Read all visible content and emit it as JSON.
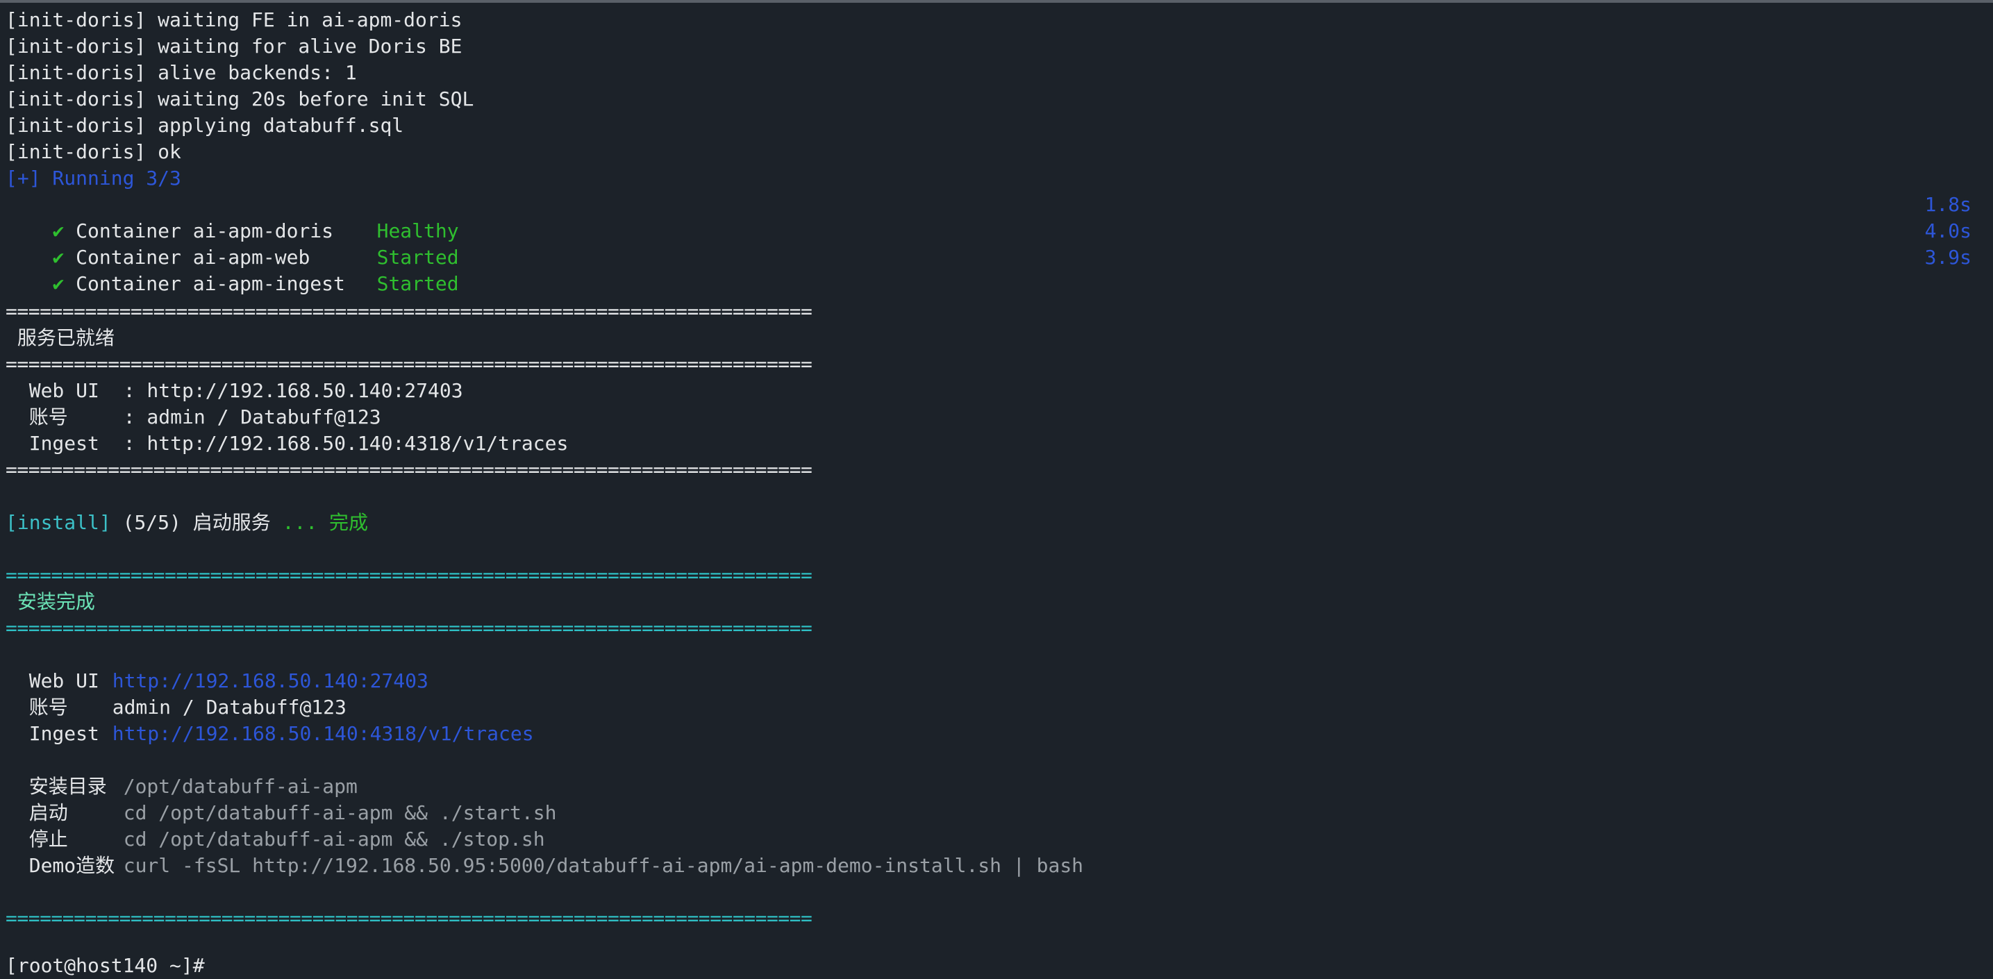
{
  "log_lines": [
    "[init-doris] waiting FE in ai-apm-doris",
    "[init-doris] waiting for alive Doris BE",
    "[init-doris] alive backends: 1",
    "[init-doris] waiting 20s before init SQL",
    "[init-doris] applying databuff.sql",
    "[init-doris] ok"
  ],
  "running": "[+] Running 3/3",
  "containers": [
    {
      "check": "✔",
      "label": "Container",
      "name": "ai-apm-doris",
      "status": "Healthy",
      "time": "1.8s"
    },
    {
      "check": "✔",
      "label": "Container",
      "name": "ai-apm-web",
      "status": "Started",
      "time": "4.0s"
    },
    {
      "check": "✔",
      "label": "Container",
      "name": "ai-apm-ingest",
      "status": "Started",
      "time": "3.9s"
    }
  ],
  "separator": "=======================================================================",
  "ready_title": "服务已就绪",
  "ready_info": [
    {
      "key": "Web UI",
      "value": ": http://192.168.50.140:27403"
    },
    {
      "key": "账号",
      "value": ": admin / Databuff@123"
    },
    {
      "key": "Ingest",
      "value": ": http://192.168.50.140:4318/v1/traces"
    }
  ],
  "install_step": {
    "prefix": "[install]",
    "step": "(5/5) 启动服务",
    "done": "... 完成"
  },
  "complete_title": "安装完成",
  "complete_info": [
    {
      "key": "Web UI",
      "value": "http://192.168.50.140:27403"
    },
    {
      "key": "账号",
      "value": "admin / Databuff@123"
    },
    {
      "key": "Ingest",
      "value": "http://192.168.50.140:4318/v1/traces"
    }
  ],
  "commands": [
    {
      "key": "安装目录",
      "value": "/opt/databuff-ai-apm"
    },
    {
      "key": "启动",
      "value": "cd /opt/databuff-ai-apm && ./start.sh"
    },
    {
      "key": "停止",
      "value": "cd /opt/databuff-ai-apm && ./stop.sh"
    },
    {
      "key": "Demo造数",
      "value": "curl -fsSL http://192.168.50.95:5000/databuff-ai-apm/ai-apm-demo-install.sh | bash"
    }
  ],
  "prompt": "[root@host140 ~]#"
}
